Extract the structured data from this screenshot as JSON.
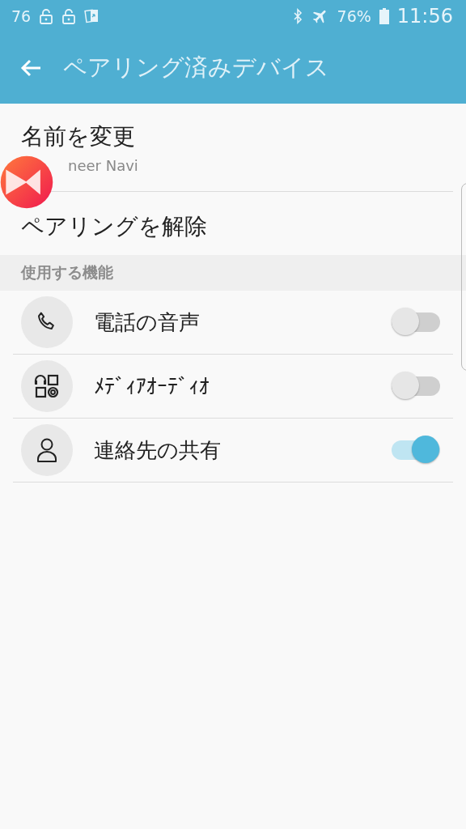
{
  "status_bar": {
    "left_text": "76",
    "battery": "76%",
    "time": "11:56"
  },
  "app_bar": {
    "title": "ペアリング済みデバイス"
  },
  "rename": {
    "title": "名前を変更",
    "subtitle": "neer Navi"
  },
  "unpair": {
    "label": "ペアリングを解除"
  },
  "section": {
    "header": "使用する機能"
  },
  "features": [
    {
      "label": "電話の音声",
      "on": false
    },
    {
      "label": "ﾒﾃﾞｨｱｵｰﾃﾞｨｵ",
      "on": false
    },
    {
      "label": "連絡先の共有",
      "on": true
    }
  ]
}
